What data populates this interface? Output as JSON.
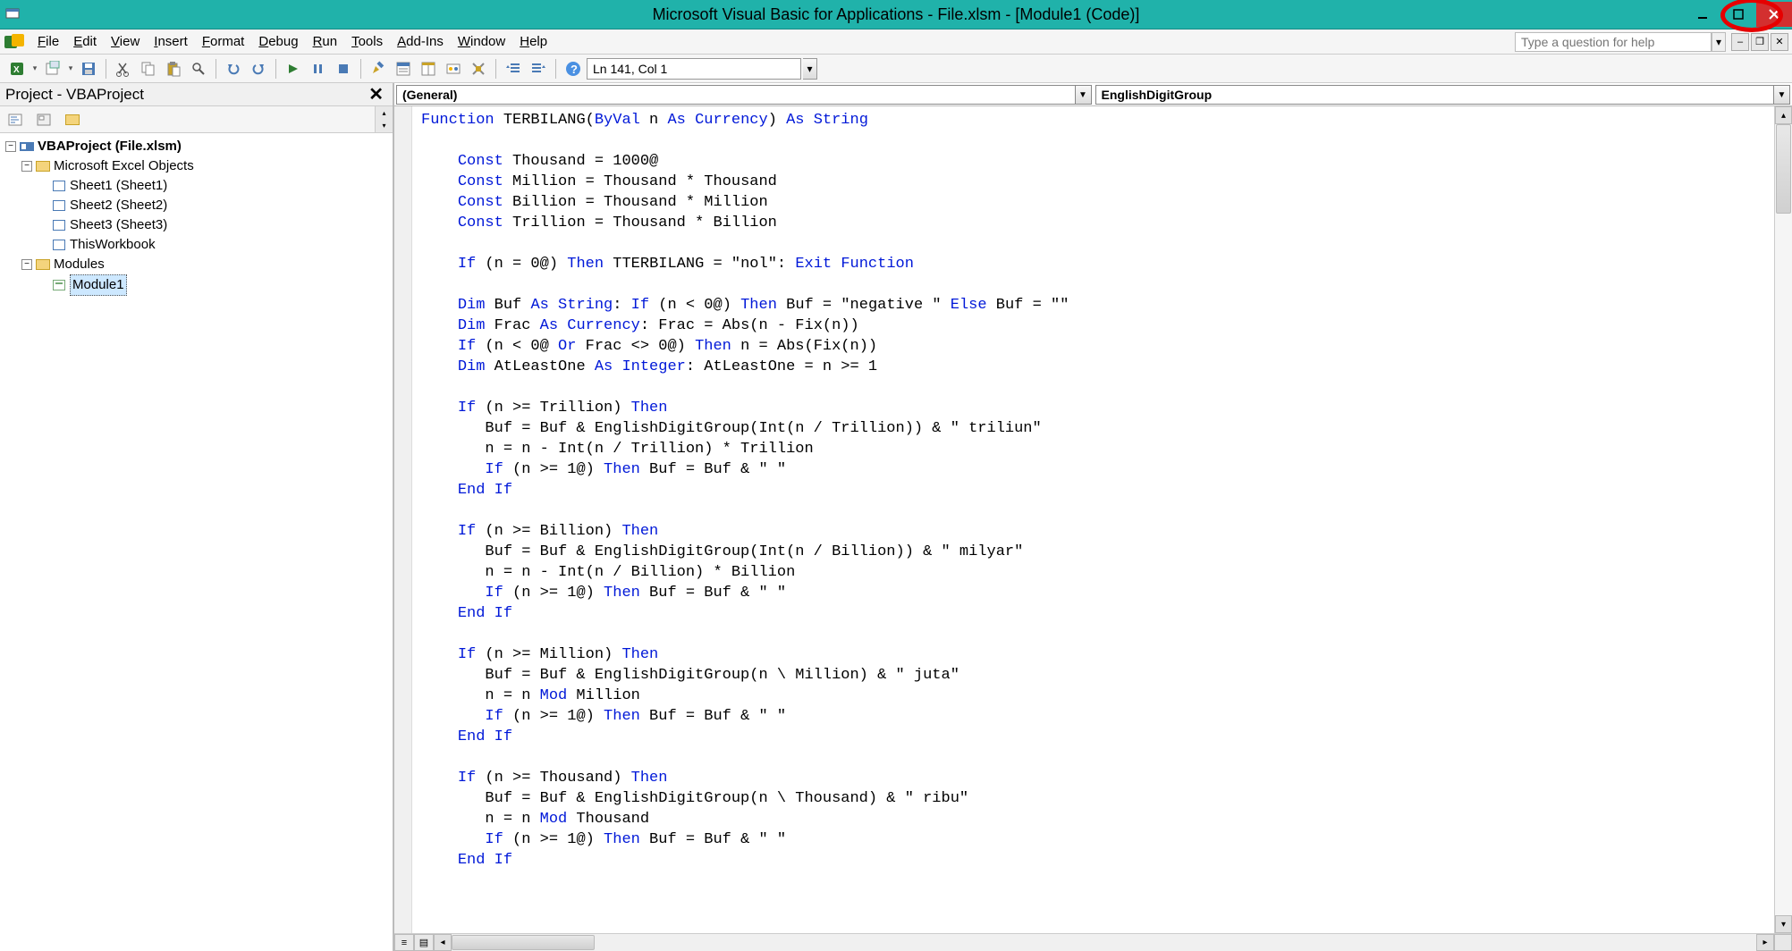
{
  "title": "Microsoft Visual Basic for Applications - File.xlsm - [Module1 (Code)]",
  "menu": [
    "File",
    "Edit",
    "View",
    "Insert",
    "Format",
    "Debug",
    "Run",
    "Tools",
    "Add-Ins",
    "Window",
    "Help"
  ],
  "help_placeholder": "Type a question for help",
  "status": "Ln 141, Col 1",
  "project": {
    "title": "Project - VBAProject",
    "root": "VBAProject (File.xlsm)",
    "excel_objects": "Microsoft Excel Objects",
    "sheets": [
      "Sheet1 (Sheet1)",
      "Sheet2 (Sheet2)",
      "Sheet3 (Sheet3)",
      "ThisWorkbook"
    ],
    "modules_label": "Modules",
    "module": "Module1"
  },
  "combo_left": "(General)",
  "combo_right": "EnglishDigitGroup",
  "code_tokens": [
    [
      {
        "k": true,
        "t": "Function"
      },
      {
        "t": " TERBILANG("
      },
      {
        "k": true,
        "t": "ByVal"
      },
      {
        "t": " n "
      },
      {
        "k": true,
        "t": "As Currency"
      },
      {
        "t": ") "
      },
      {
        "k": true,
        "t": "As String"
      }
    ],
    [],
    [
      {
        "t": "    "
      },
      {
        "k": true,
        "t": "Const"
      },
      {
        "t": " Thousand = 1000@"
      }
    ],
    [
      {
        "t": "    "
      },
      {
        "k": true,
        "t": "Const"
      },
      {
        "t": " Million = Thousand * Thousand"
      }
    ],
    [
      {
        "t": "    "
      },
      {
        "k": true,
        "t": "Const"
      },
      {
        "t": " Billion = Thousand * Million"
      }
    ],
    [
      {
        "t": "    "
      },
      {
        "k": true,
        "t": "Const"
      },
      {
        "t": " Trillion = Thousand * Billion"
      }
    ],
    [],
    [
      {
        "t": "    "
      },
      {
        "k": true,
        "t": "If"
      },
      {
        "t": " (n = 0@) "
      },
      {
        "k": true,
        "t": "Then"
      },
      {
        "t": " TTERBILANG = \"nol\": "
      },
      {
        "k": true,
        "t": "Exit Function"
      }
    ],
    [],
    [
      {
        "t": "    "
      },
      {
        "k": true,
        "t": "Dim"
      },
      {
        "t": " Buf "
      },
      {
        "k": true,
        "t": "As String"
      },
      {
        "t": ": "
      },
      {
        "k": true,
        "t": "If"
      },
      {
        "t": " (n < 0@) "
      },
      {
        "k": true,
        "t": "Then"
      },
      {
        "t": " Buf = \"negative \" "
      },
      {
        "k": true,
        "t": "Else"
      },
      {
        "t": " Buf = \"\""
      }
    ],
    [
      {
        "t": "    "
      },
      {
        "k": true,
        "t": "Dim"
      },
      {
        "t": " Frac "
      },
      {
        "k": true,
        "t": "As Currency"
      },
      {
        "t": ": Frac = Abs(n - Fix(n))"
      }
    ],
    [
      {
        "t": "    "
      },
      {
        "k": true,
        "t": "If"
      },
      {
        "t": " (n < 0@ "
      },
      {
        "k": true,
        "t": "Or"
      },
      {
        "t": " Frac <> 0@) "
      },
      {
        "k": true,
        "t": "Then"
      },
      {
        "t": " n = Abs(Fix(n))"
      }
    ],
    [
      {
        "t": "    "
      },
      {
        "k": true,
        "t": "Dim"
      },
      {
        "t": " AtLeastOne "
      },
      {
        "k": true,
        "t": "As Integer"
      },
      {
        "t": ": AtLeastOne = n >= 1"
      }
    ],
    [],
    [
      {
        "t": "    "
      },
      {
        "k": true,
        "t": "If"
      },
      {
        "t": " (n >= Trillion) "
      },
      {
        "k": true,
        "t": "Then"
      }
    ],
    [
      {
        "t": "       Buf = Buf & EnglishDigitGroup(Int(n / Trillion)) & \" triliun\""
      }
    ],
    [
      {
        "t": "       n = n - Int(n / Trillion) * Trillion"
      }
    ],
    [
      {
        "t": "       "
      },
      {
        "k": true,
        "t": "If"
      },
      {
        "t": " (n >= 1@) "
      },
      {
        "k": true,
        "t": "Then"
      },
      {
        "t": " Buf = Buf & \" \""
      }
    ],
    [
      {
        "t": "    "
      },
      {
        "k": true,
        "t": "End If"
      }
    ],
    [],
    [
      {
        "t": "    "
      },
      {
        "k": true,
        "t": "If"
      },
      {
        "t": " (n >= Billion) "
      },
      {
        "k": true,
        "t": "Then"
      }
    ],
    [
      {
        "t": "       Buf = Buf & EnglishDigitGroup(Int(n / Billion)) & \" milyar\""
      }
    ],
    [
      {
        "t": "       n = n - Int(n / Billion) * Billion"
      }
    ],
    [
      {
        "t": "       "
      },
      {
        "k": true,
        "t": "If"
      },
      {
        "t": " (n >= 1@) "
      },
      {
        "k": true,
        "t": "Then"
      },
      {
        "t": " Buf = Buf & \" \""
      }
    ],
    [
      {
        "t": "    "
      },
      {
        "k": true,
        "t": "End If"
      }
    ],
    [],
    [
      {
        "t": "    "
      },
      {
        "k": true,
        "t": "If"
      },
      {
        "t": " (n >= Million) "
      },
      {
        "k": true,
        "t": "Then"
      }
    ],
    [
      {
        "t": "       Buf = Buf & EnglishDigitGroup(n \\ Million) & \" juta\""
      }
    ],
    [
      {
        "t": "       n = n "
      },
      {
        "k": true,
        "t": "Mod"
      },
      {
        "t": " Million"
      }
    ],
    [
      {
        "t": "       "
      },
      {
        "k": true,
        "t": "If"
      },
      {
        "t": " (n >= 1@) "
      },
      {
        "k": true,
        "t": "Then"
      },
      {
        "t": " Buf = Buf & \" \""
      }
    ],
    [
      {
        "t": "    "
      },
      {
        "k": true,
        "t": "End If"
      }
    ],
    [],
    [
      {
        "t": "    "
      },
      {
        "k": true,
        "t": "If"
      },
      {
        "t": " (n >= Thousand) "
      },
      {
        "k": true,
        "t": "Then"
      }
    ],
    [
      {
        "t": "       Buf = Buf & EnglishDigitGroup(n \\ Thousand) & \" ribu\""
      }
    ],
    [
      {
        "t": "       n = n "
      },
      {
        "k": true,
        "t": "Mod"
      },
      {
        "t": " Thousand"
      }
    ],
    [
      {
        "t": "       "
      },
      {
        "k": true,
        "t": "If"
      },
      {
        "t": " (n >= 1@) "
      },
      {
        "k": true,
        "t": "Then"
      },
      {
        "t": " Buf = Buf & \" \""
      }
    ],
    [
      {
        "t": "    "
      },
      {
        "k": true,
        "t": "End If"
      }
    ],
    []
  ]
}
